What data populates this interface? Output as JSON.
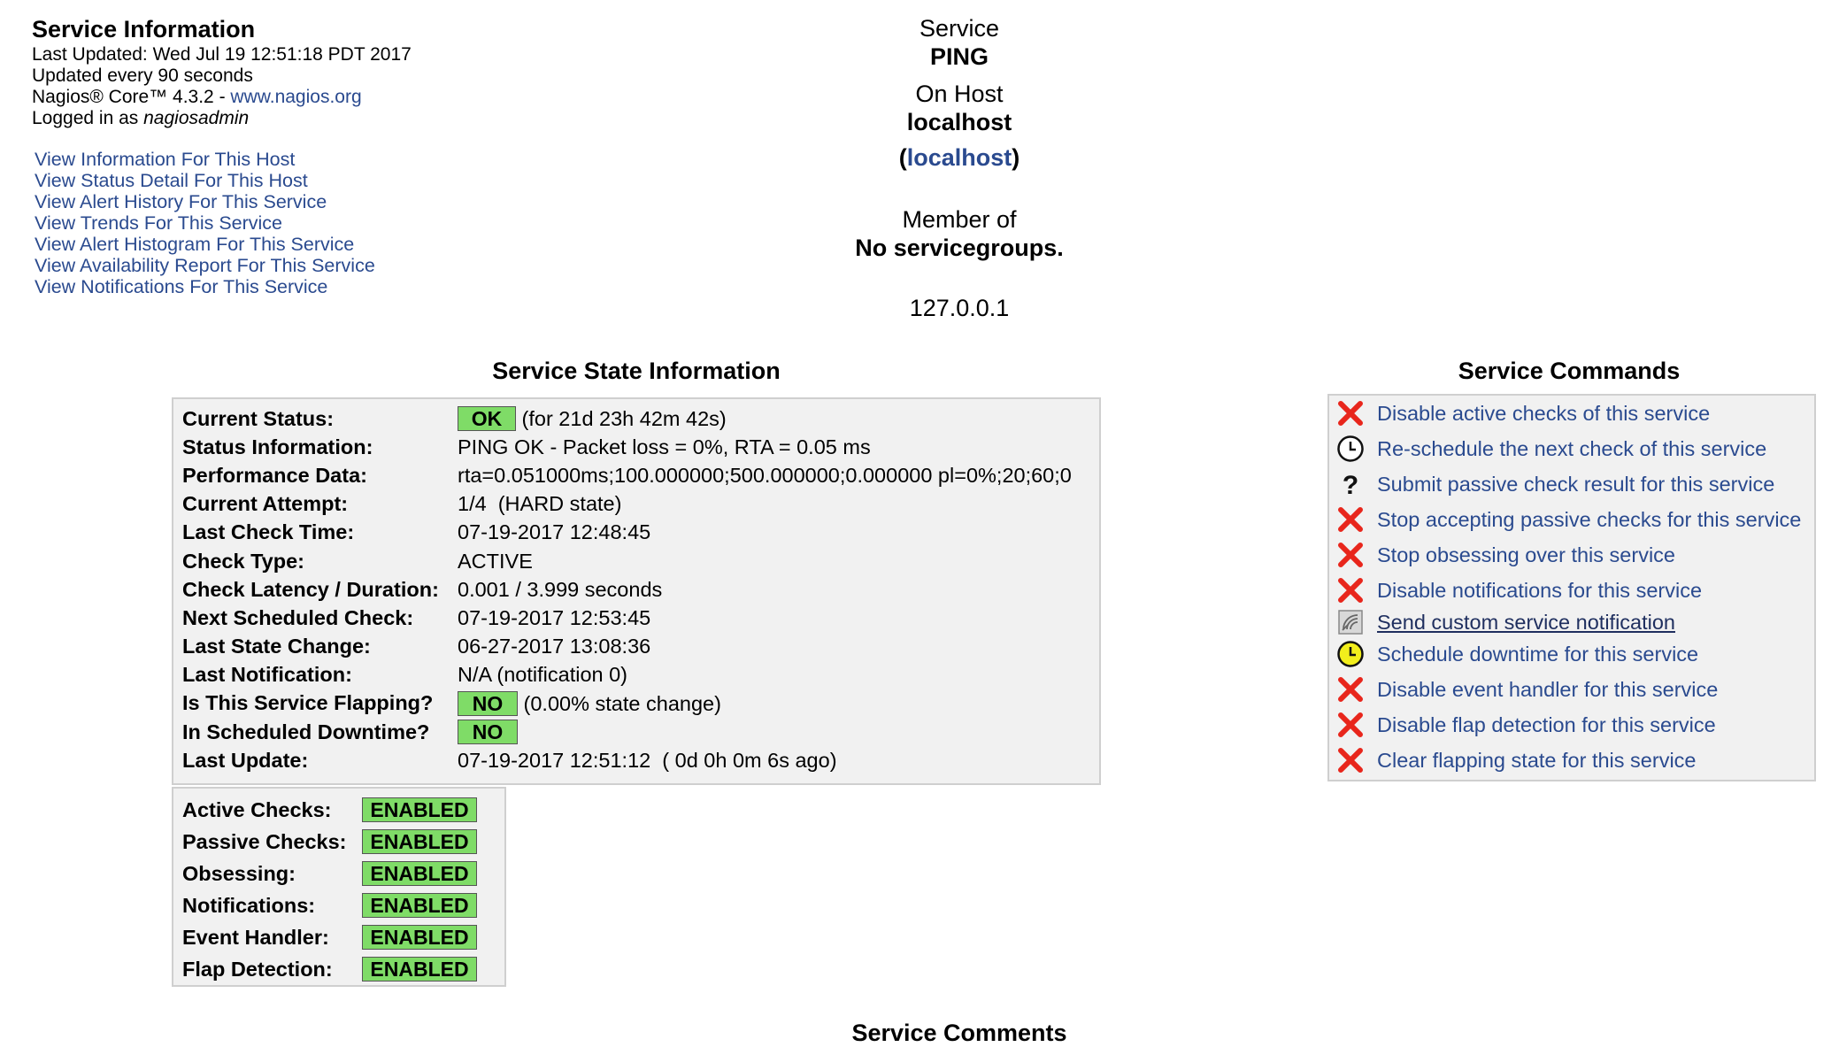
{
  "info": {
    "title": "Service Information",
    "last_updated": "Last Updated: Wed Jul 19 12:51:18 PDT 2017",
    "update_interval": "Updated every 90 seconds",
    "version_prefix": "Nagios® Core™ 4.3.2 - ",
    "version_link": "www.nagios.org",
    "logged_in_prefix": "Logged in as ",
    "user": "nagiosadmin"
  },
  "nav_links": [
    "View Information For This Host",
    "View Status Detail For This Host",
    "View Alert History For This Service",
    "View Trends For This Service",
    "View Alert Histogram For This Service",
    "View Availability Report For This Service",
    "View Notifications For This Service"
  ],
  "header": {
    "service_label": "Service",
    "service_name": "PING",
    "host_label": "On Host",
    "host_name": "localhost",
    "host_alias": "localhost",
    "member_label": "Member of",
    "member_value": "No servicegroups.",
    "address": "127.0.0.1"
  },
  "state": {
    "title": "Service State Information",
    "rows": [
      {
        "key": "Current Status:",
        "badge": "OK",
        "value": "(for 21d 23h 42m 42s)"
      },
      {
        "key": "Status Information:",
        "value": "PING OK - Packet loss = 0%, RTA = 0.05 ms"
      },
      {
        "key": "Performance Data:",
        "value": "rta=0.051000ms;100.000000;500.000000;0.000000 pl=0%;20;60;0"
      },
      {
        "key": "Current Attempt:",
        "value": "1/4  (HARD state)"
      },
      {
        "key": "Last Check Time:",
        "value": "07-19-2017 12:48:45"
      },
      {
        "key": "Check Type:",
        "value": "ACTIVE"
      },
      {
        "key": "Check Latency / Duration:",
        "value": "0.001 / 3.999 seconds"
      },
      {
        "key": "Next Scheduled Check:",
        "value": "07-19-2017 12:53:45"
      },
      {
        "key": "Last State Change:",
        "value": "06-27-2017 13:08:36"
      },
      {
        "key": "Last Notification:",
        "value": "N/A (notification 0)"
      },
      {
        "key": "Is This Service Flapping?",
        "badge": "NO",
        "value": "(0.00% state change)"
      },
      {
        "key": "In Scheduled Downtime?",
        "badge": "NO",
        "value": ""
      },
      {
        "key": "Last Update:",
        "value": "07-19-2017 12:51:12  ( 0d 0h 0m 6s ago)"
      }
    ]
  },
  "flags": [
    {
      "key": "Active Checks:",
      "value": "ENABLED"
    },
    {
      "key": "Passive Checks:",
      "value": "ENABLED"
    },
    {
      "key": "Obsessing:",
      "value": "ENABLED"
    },
    {
      "key": "Notifications:",
      "value": "ENABLED"
    },
    {
      "key": "Event Handler:",
      "value": "ENABLED"
    },
    {
      "key": "Flap Detection:",
      "value": "ENABLED"
    }
  ],
  "commands": {
    "title": "Service Commands",
    "items": [
      {
        "icon": "red-x-icon",
        "label": "Disable active checks of this service"
      },
      {
        "icon": "clock-icon",
        "label": "Re-schedule the next check of this service"
      },
      {
        "icon": "question-icon",
        "label": "Submit passive check result for this service"
      },
      {
        "icon": "red-x-icon",
        "label": "Stop accepting passive checks for this service"
      },
      {
        "icon": "red-x-icon",
        "label": "Stop obsessing over this service"
      },
      {
        "icon": "red-x-icon",
        "label": "Disable notifications for this service"
      },
      {
        "icon": "notification-icon",
        "label": "Send custom service notification"
      },
      {
        "icon": "downtime-clock-icon",
        "label": "Schedule downtime for this service"
      },
      {
        "icon": "red-x-icon",
        "label": "Disable event handler for this service"
      },
      {
        "icon": "red-x-icon",
        "label": "Disable flap detection for this service"
      },
      {
        "icon": "red-x-icon",
        "label": "Clear flapping state for this service"
      }
    ]
  },
  "comments": {
    "title": "Service Comments"
  },
  "colors": {
    "ok_badge": "#7fdc67",
    "link": "#2a4a8f",
    "panel_bg": "#f1f1f1",
    "x_red": "#e8261c",
    "downtime_yellow": "#f2ee1c"
  }
}
